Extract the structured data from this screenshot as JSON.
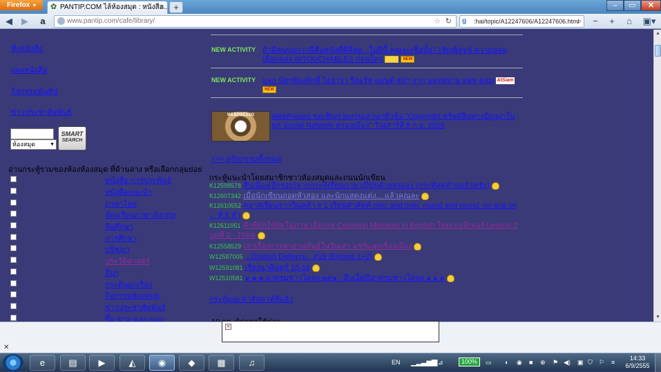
{
  "browser": {
    "app_button": "Firefox",
    "tab_title": "PANTIP.COM ไล้ห้องสมุด : หนังสือ...",
    "url": "www.pantip.com/cafe/library/",
    "search_text": ":hai/topic/A12247606/A12247606.html"
  },
  "sidebar": {
    "links": [
      "ที่งหนังสือ",
      "แผงหนังสือ",
      "กิจกรรมพันทิป",
      "ข่าวประชาสัมพันธ์"
    ],
    "search_select": "ห้องสมุด",
    "smart_search_line1": "SMART",
    "smart_search_line2": "SEARCH",
    "group_hint": "อ่านกระทู้รวมของห้องห้องสมุด ที่ด้านล่าง หรือเลือกกลุ่มย่อย",
    "categories": [
      {
        "label": "หนังสือ-การประพันธ์",
        "visited": false
      },
      {
        "label": "หนังสือแนะนำ",
        "visited": false
      },
      {
        "label": "ภาษาไทย",
        "visited": false
      },
      {
        "label": "ห้องเรียนภาษาอังกฤษ",
        "visited": false
      },
      {
        "label": "จีนศึกษา",
        "visited": false
      },
      {
        "label": "การศึกษา",
        "visited": false
      },
      {
        "label": "ปรัชญา",
        "visited": false
      },
      {
        "label": "ประวัติศาสตร์",
        "visited": true
      },
      {
        "label": "อื่นๆ",
        "visited": false
      },
      {
        "label": "กระทู้นอกเรื่อง",
        "visited": false
      },
      {
        "label": "กิจกรรมห้องสมุด",
        "visited": false
      },
      {
        "label": "ข่าวประชาสัมพันธ์",
        "visited": false
      },
      {
        "label": "ซื้อ-ขาย-แลก-แจก",
        "visited": false
      }
    ]
  },
  "activities": {
    "label": "NEW ACTIVITY",
    "items": [
      {
        "text": "ถ้ามีคนบอกว่านี่คือหนังที่ดีที่สุด...ในปีนี้ คุณจะเชื่อมั้ย? เชิญพิสูจน์ ความยอดเยี่ยมของ INTOUCHABLES ก่อนใคร",
        "tag": "NEW"
      },
      {
        "text": "แจก บัตรห้องพักที่ ไอธารา รีสอร์ท แอนด์ สปา จาก แอทสยาม ดอท คอม",
        "tag": "NEW",
        "logo": "AtSiam"
      }
    ],
    "webpresso_logo": "WEBPRESSO",
    "webpresso_text": "WebPresso ขอเชิญร่วมงานเสวนาหัวข้อ \"Copyright ทรัพย์สินทางปัญญาในยุค Social Network ครองเมือง\" วันเสาร์ที่ 8 ก.ย. 2555",
    "all_link": ">>> ดูกิจกรรมทั้งหมด"
  },
  "recommended": {
    "title": "กระทู้แนะนำโดยสมาชิกชาวห้องสมุดและถนนนักเขียน",
    "topics": [
      {
        "id": "K12598578",
        "title": "สืบเนื่อง(อีกรอบ)จากกระทู้เรียนภาษาญี่ปุ่นด้วยตนเอง (กระทู้สุดท้ายแล้วครับ)",
        "style": "link"
      },
      {
        "id": "K12607342",
        "title": "เมื่อนักเขียนถอดหัวสอง และนักแสดงแต่ง... แล้วคุณละ",
        "style": "faint"
      },
      {
        "id": "K12610552",
        "title": "คลาสเรียนจากวินคค้า # 1 เรียนคำศัพท์ over and over, round and round, on and on ... ที่ 8 คำ",
        "style": "link"
      },
      {
        "id": "K12611051",
        "title": "คำที่มักใช้ผิดในภาษาอังกฤษ Common Mistakes in English โดยเจนนีเฟอร์ Lesson 2 บทที่ 2 - Think",
        "style": "visited"
      },
      {
        "id": "K12558529",
        "title": "เล่าเรื่องการหาอ่านพันธ์ในวันเสา แชร์แลกเรื่องเมือง",
        "style": "visited"
      },
      {
        "id": "W12587005",
        "title": "...Dragon Delivery....#19 (Encore 1+2)",
        "style": "link"
      },
      {
        "id": "W12591081",
        "title": "เรียงนาคินทร์ 15-16",
        "style": "link"
      },
      {
        "id": "W12510581",
        "title": "๑ ๑ ๑ อาศรมชาวโคลง ๒๙๑ : สืบเอ็ดปีอาศรมชาวโคลง ๑ ๑ ๑",
        "style": "link"
      }
    ],
    "weekly_link": "กระทู้แนะนำสัปดาห์ที่แล้ว",
    "latest_title": "10 กระทู้ล่าสุดใต้ข่าว"
  },
  "taskbar": {
    "language": "EN",
    "battery": "100%",
    "time": "14:33",
    "date": "6/9/2555"
  }
}
